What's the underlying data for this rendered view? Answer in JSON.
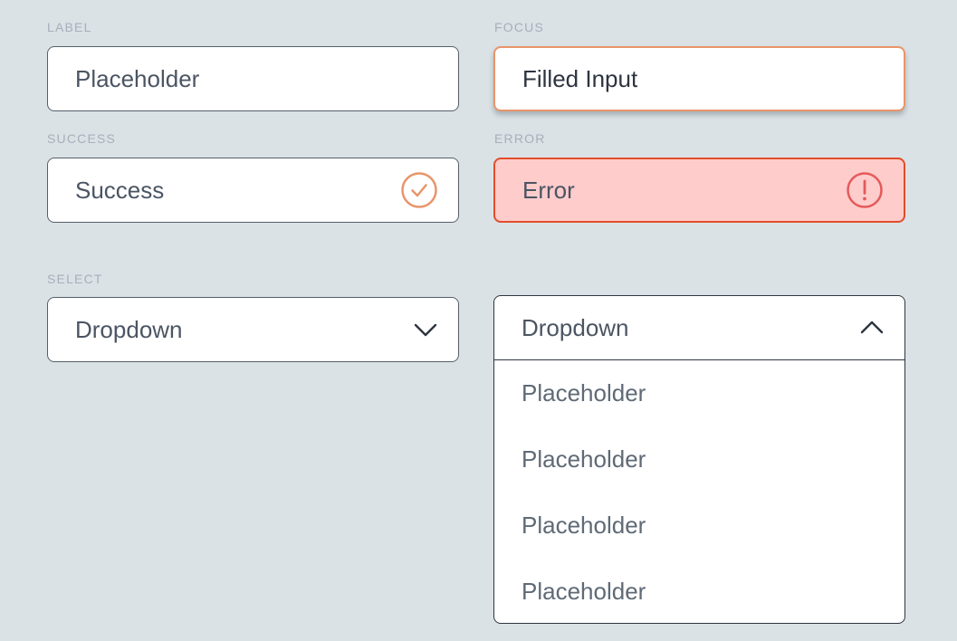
{
  "fields": {
    "default": {
      "label": "LABEL",
      "placeholder": "Placeholder"
    },
    "focus": {
      "label": "FOCUS",
      "value": "Filled Input"
    },
    "success": {
      "label": "SUCCESS",
      "value": "Success",
      "icon": "check-circle-icon",
      "icon_color": "#e8956a"
    },
    "error": {
      "label": "ERROR",
      "value": "Error",
      "icon": "alert-circle-icon",
      "icon_color": "#e55a5a"
    }
  },
  "select": {
    "label": "SELECT",
    "value": "Dropdown",
    "icon": "chevron-down-icon"
  },
  "open_select": {
    "value": "Dropdown",
    "icon": "chevron-up-icon",
    "options": [
      "Placeholder",
      "Placeholder",
      "Placeholder",
      "Placeholder"
    ]
  },
  "colors": {
    "background": "#dbe2e6",
    "focus_border": "#e8956a",
    "error_border": "#e14d2a",
    "error_fill": "#ffcccc",
    "border": "#56606a"
  }
}
